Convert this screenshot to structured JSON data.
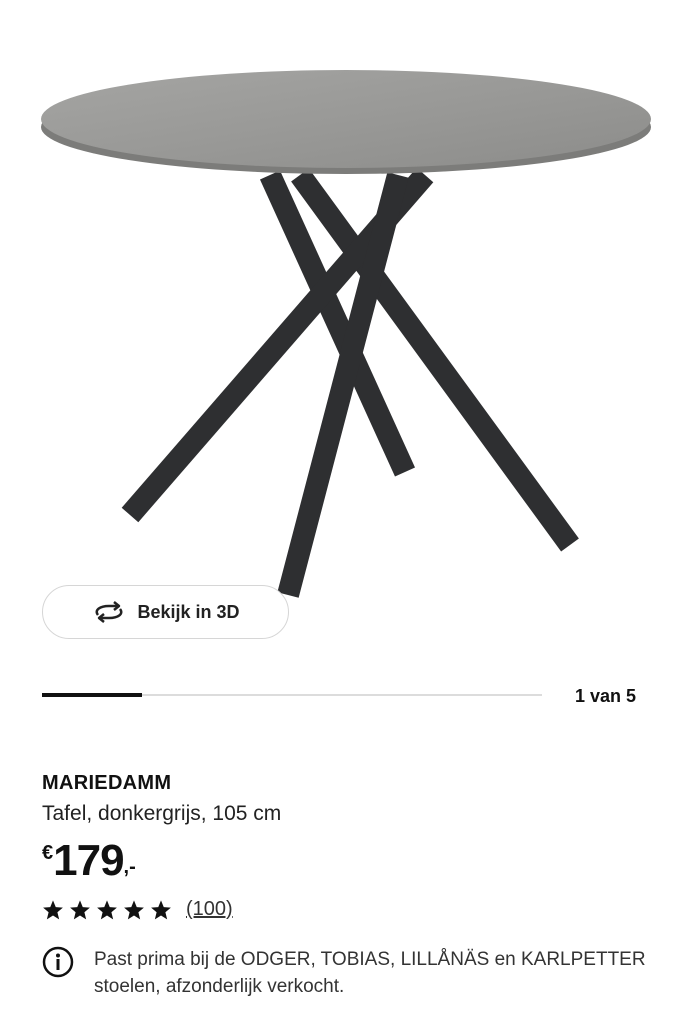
{
  "gallery": {
    "view_3d_label": "Bekijk in 3D",
    "pager_text": "1 van 5",
    "current_index": 1,
    "total_images": 5,
    "progress_fraction": 0.2
  },
  "product": {
    "name": "MARIEDAMM",
    "description": "Tafel, donkergrijs, 105 cm",
    "price": {
      "currency": "€",
      "amount": "179",
      "suffix": ",-"
    },
    "rating": {
      "stars": 5,
      "max_stars": 5,
      "count_text": "(100)"
    },
    "info_text": "Past prima bij de ODGER, TOBIAS, LILLÅNÄS en KARLPETTER stoelen, afzonderlijk verkocht."
  },
  "icons": {
    "view_3d": "rotate-3d-icon",
    "star": "star-icon",
    "info": "info-icon"
  },
  "colors": {
    "text": "#111111",
    "tabletop": "#9a9a98",
    "legs": "#2e2f31",
    "button_border": "#d6d6d6"
  }
}
